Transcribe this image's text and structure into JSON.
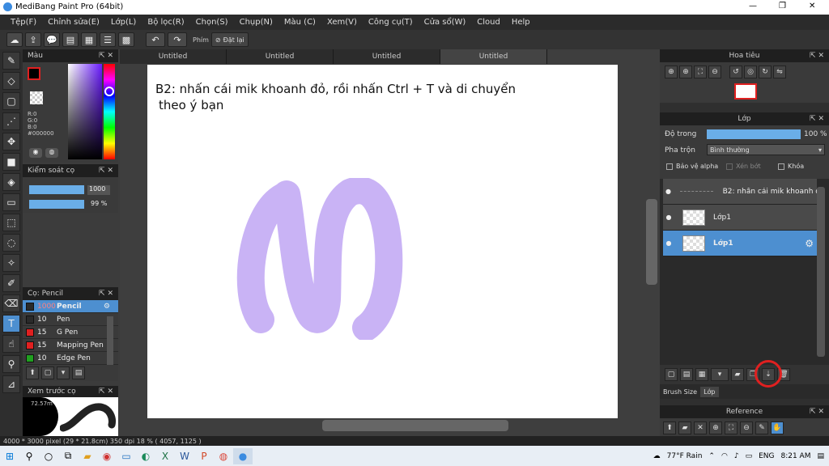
{
  "window": {
    "title": "MediBang Paint Pro (64bit)",
    "minimize": "—",
    "maximize": "❐",
    "close": "✕"
  },
  "menu": [
    "Tệp(F)",
    "Chỉnh sửa(E)",
    "Lớp(L)",
    "Bộ lọc(R)",
    "Chọn(S)",
    "Chụp(N)",
    "Màu (C)",
    "Xem(V)",
    "Công cụ(T)",
    "Cửa sổ(W)",
    "Cloud",
    "Help"
  ],
  "toolbar": {
    "shortcut_label": "Phím",
    "reset_label": "Đặt lại"
  },
  "color_panel": {
    "title": "Màu",
    "r": "R:0",
    "g": "G:0",
    "b": "B:0",
    "hex": "#000000"
  },
  "brush_control": {
    "title": "Kiểm soát cọ",
    "size": "1000",
    "opacity": "99 %"
  },
  "brush_panel": {
    "title": "Cọ: Pencil",
    "items": [
      {
        "size": "1000",
        "name": "Pencil",
        "color": "#2a2a2a"
      },
      {
        "size": "10",
        "name": "Pen",
        "color": "#2a2a2a"
      },
      {
        "size": "15",
        "name": "G Pen",
        "color": "#e02020"
      },
      {
        "size": "15",
        "name": "Mapping Pen",
        "color": "#e02020"
      },
      {
        "size": "10",
        "name": "Edge Pen",
        "color": "#20a020"
      }
    ]
  },
  "preview_panel": {
    "title": "Xem trước cọ",
    "value": "72.57m"
  },
  "tabs": [
    "Untitled",
    "Untitled",
    "Untitled",
    "Untitled"
  ],
  "canvas": {
    "text_line1": "B2: nhấn cái mik khoanh đỏ, rồi nhấn Ctrl + T và di chuyển",
    "text_line2": "theo ý bạn",
    "stroke_color": "#c9b3f5"
  },
  "navigator": {
    "title": "Hoa tiêu"
  },
  "layer_panel": {
    "title": "Lớp",
    "opacity_label": "Độ trong",
    "opacity_value": "100 %",
    "blend_label": "Pha trộn",
    "blend_value": "Bình thường",
    "protect_alpha": "Bảo vệ alpha",
    "clipping": "Xén bớt",
    "lock": "Khóa",
    "layers": [
      {
        "name": "B2: nhấn cái mik khoanh đỏ"
      },
      {
        "name": "Lớp1"
      },
      {
        "name": "Lớp1"
      }
    ]
  },
  "bottom_tabs": [
    "Brush Size",
    "Lớp"
  ],
  "reference": {
    "title": "Reference"
  },
  "status": {
    "text": "4000 * 3000 pixel   (29 * 21.8cm)   350 dpi   18 %   ( 4057, 1125 )"
  },
  "taskbar": {
    "weather": "77°F  Rain",
    "lang": "ENG",
    "time": "8:21 AM"
  }
}
